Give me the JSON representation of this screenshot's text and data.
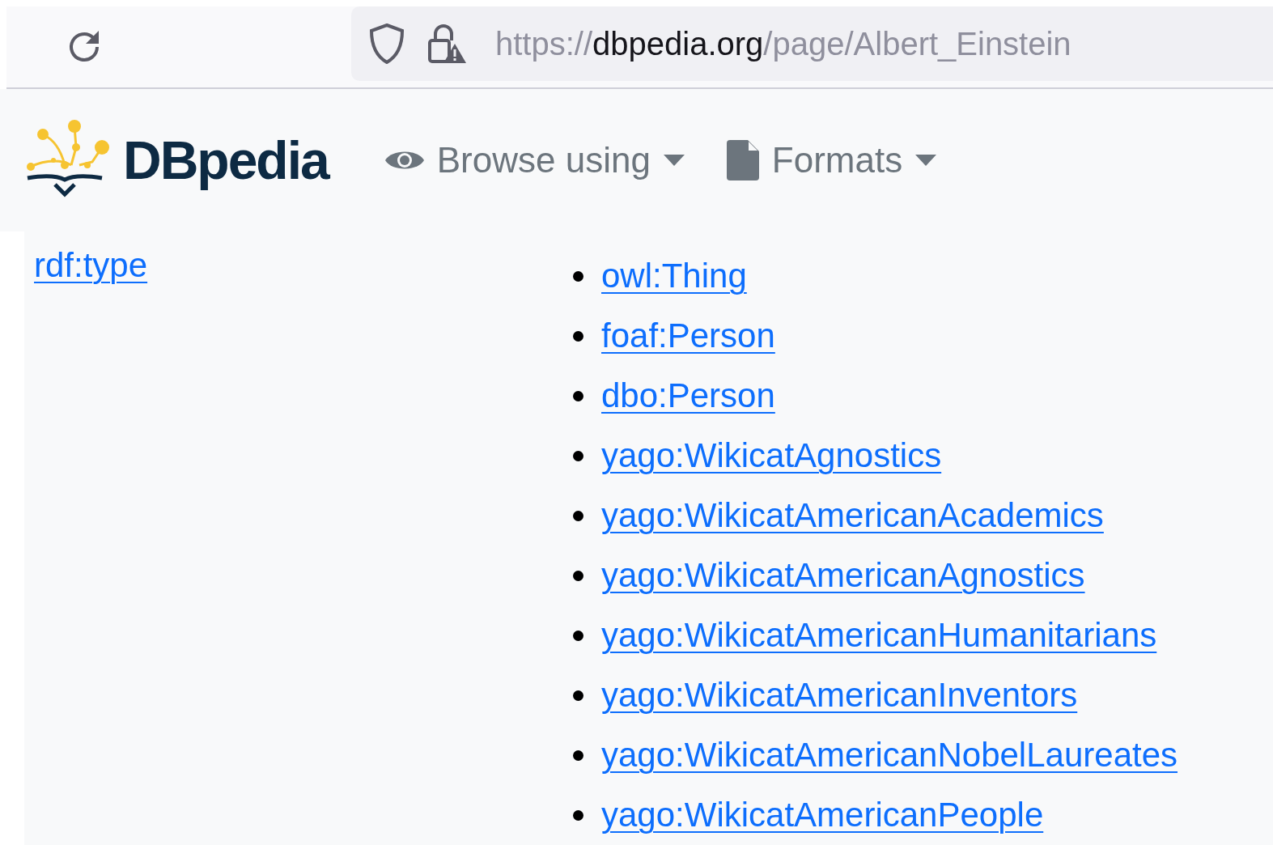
{
  "browser": {
    "url": {
      "scheme": "https://",
      "host": "dbpedia.org",
      "path": "/page/Albert_Einstein"
    }
  },
  "navbar": {
    "brand": "DBpedia",
    "menus": [
      {
        "kind": "eye",
        "label": "Browse using"
      },
      {
        "kind": "file",
        "label": "Formats"
      }
    ]
  },
  "property": {
    "label": "rdf:type",
    "values": [
      "owl:Thing",
      "foaf:Person",
      "dbo:Person",
      "yago:WikicatAgnostics",
      "yago:WikicatAmericanAcademics",
      "yago:WikicatAmericanAgnostics",
      "yago:WikicatAmericanHumanitarians",
      "yago:WikicatAmericanInventors",
      "yago:WikicatAmericanNobelLaureates",
      "yago:WikicatAmericanPeople"
    ]
  }
}
